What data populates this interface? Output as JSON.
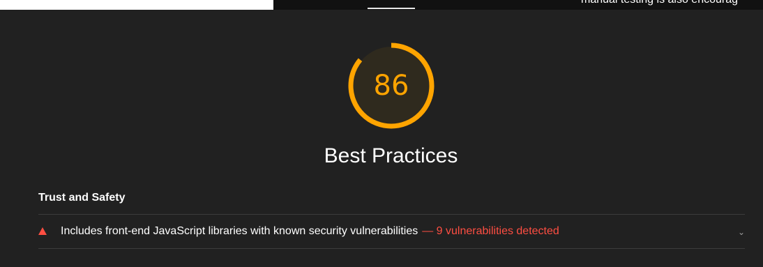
{
  "top_overlay": {
    "note_text": "manual testing is also encourag"
  },
  "category": {
    "score": "86",
    "title": "Best Practices",
    "score_fraction": 0.86,
    "score_color": "#ffa400"
  },
  "groups": [
    {
      "title": "Trust and Safety",
      "audits": [
        {
          "title": "Includes front-end JavaScript libraries with known security vulnerabilities",
          "display_value": "— 9 vulnerabilities detected",
          "status_color": "#ff4e42",
          "icon": "fail-triangle-icon"
        }
      ]
    }
  ]
}
